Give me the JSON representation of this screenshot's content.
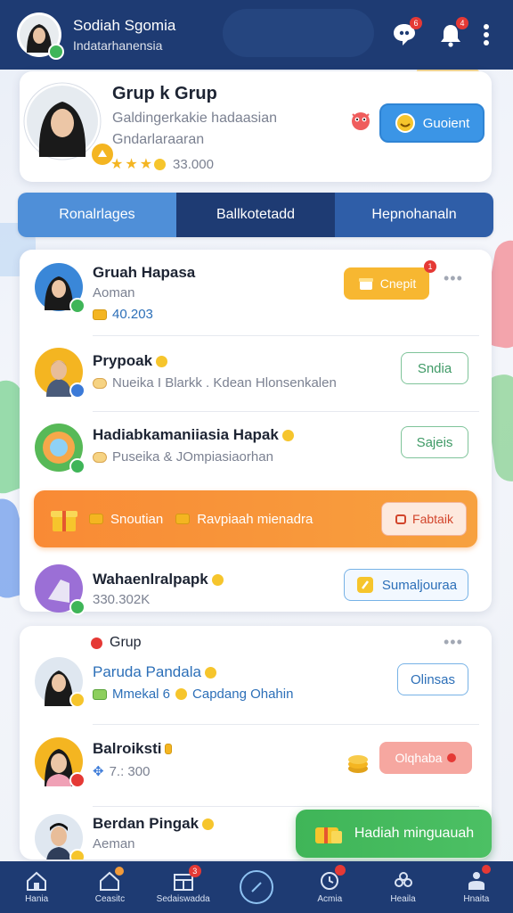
{
  "appbar": {
    "title": "Sodiah Sgomia",
    "subtitle": "Indatarhanensia",
    "chat_badge": "6",
    "alert_badge": "4"
  },
  "profile": {
    "name": "Grup k Grup",
    "desc_line1": "Galdingerkakie hadaasian",
    "desc_line2": "Gndarlaraaran",
    "rating_value": "33.000",
    "stars": 3,
    "primary_button": "Guoient"
  },
  "tabs": [
    {
      "label": "Ronalrlages"
    },
    {
      "label": "Ballkotetadd"
    },
    {
      "label": "Hepnohanaln"
    }
  ],
  "list": {
    "rows": [
      {
        "name": "Gruah Hapasa",
        "sub": "Aoman",
        "amount": "40.203",
        "button": "Cnepit",
        "button_badge": "1"
      },
      {
        "name": "Prypoak",
        "sub": "Nueika I Blarkk . Kdean Hlonsenkalen",
        "button": "Sndia"
      },
      {
        "name": "Hadiabkamaniiasia Hapak",
        "sub": "Puseika  &  JOmpiasiaorhan",
        "button": "Sajeis"
      },
      {
        "name": "Wahaenlralpapk",
        "sub": "330.302K",
        "button": "Sumaljouraa"
      }
    ],
    "banner": {
      "text1": "Snoutian",
      "text2": "Ravpiaah mienadra",
      "button": "Fabtaik"
    }
  },
  "group": {
    "title": "Grup",
    "rows": [
      {
        "name": "Paruda Pandala",
        "sub_a": "Mmekal 6",
        "sub_b": "Capdang Ohahin",
        "button": "Olinsas"
      },
      {
        "name": "Balroiksti",
        "sub": "7.: 300",
        "button": "Olqhaba"
      },
      {
        "name": "Berdan Pingak",
        "sub": "Aeman"
      }
    ],
    "fab": "Hadiah minguauah"
  },
  "bottom_nav": [
    {
      "label": "Hania"
    },
    {
      "label": "Ceasitc"
    },
    {
      "label": "Sedaiswadda",
      "badge": "3"
    },
    {
      "label": ""
    },
    {
      "label": "Acmia"
    },
    {
      "label": "Heaila"
    },
    {
      "label": "Hnaita"
    }
  ],
  "colors": {
    "navy": "#1e3b73",
    "primary_blue": "#3b95e6",
    "orange": "#f98a35",
    "green": "#3fb558",
    "gold": "#f4b521"
  }
}
